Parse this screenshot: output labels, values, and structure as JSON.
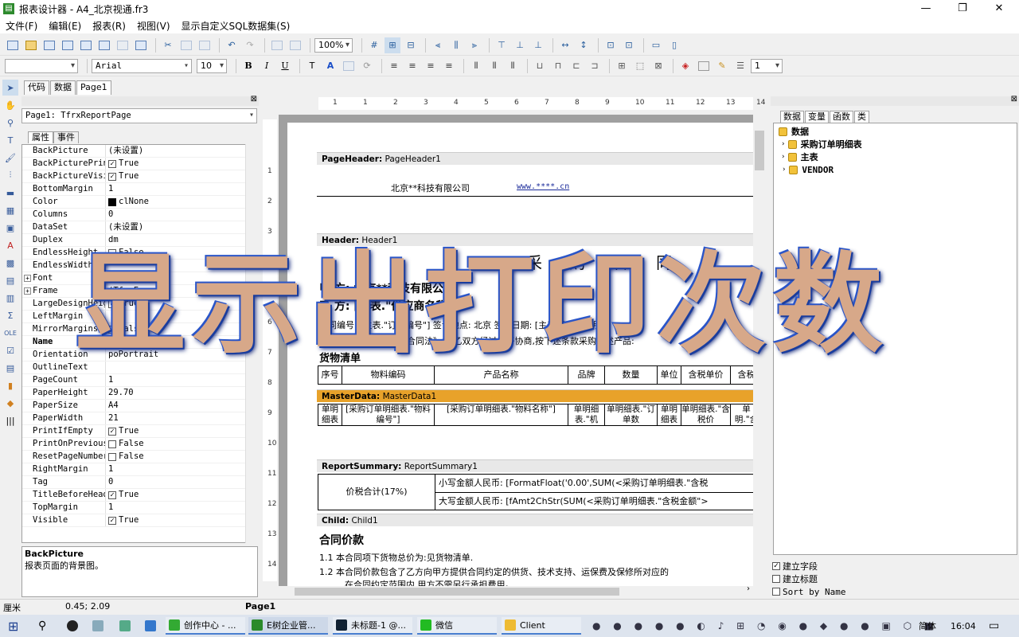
{
  "window": {
    "title": "报表设计器 - A4_北京视通.fr3",
    "minimize": "—",
    "restore": "❐",
    "close": "✕"
  },
  "menu": [
    "文件(F)",
    "编辑(E)",
    "报表(R)",
    "视图(V)",
    "显示自定义SQL数据集(S)"
  ],
  "toolbar": {
    "zoom": "100%",
    "font_name": "Arial",
    "font_size": "10",
    "line_width": "1",
    "style_combo": ""
  },
  "format_buttons": {
    "bold": "B",
    "italic": "I",
    "underline": "U"
  },
  "design_tabs": [
    "代码",
    "数据",
    "Page1"
  ],
  "page_selector": "Page1: TfrxReportPage",
  "prop_tabs": [
    "属性",
    "事件"
  ],
  "properties": [
    {
      "name": "BackPicture",
      "value": "(未设置)",
      "button": "…"
    },
    {
      "name": "BackPicturePrin",
      "value": "True",
      "check": true
    },
    {
      "name": "BackPictureVisi",
      "value": "True",
      "check": true
    },
    {
      "name": "BottomMargin",
      "value": "1"
    },
    {
      "name": "Color",
      "value": "clNone",
      "swatch": true
    },
    {
      "name": "Columns",
      "value": "0"
    },
    {
      "name": "DataSet",
      "value": "(未设置)"
    },
    {
      "name": "Duplex",
      "value": "dm"
    },
    {
      "name": "EndlessHeight",
      "value": "False",
      "check": false
    },
    {
      "name": "EndlessWidth",
      "value": ""
    },
    {
      "name": "Font",
      "value": "(TFont)",
      "expand": true
    },
    {
      "name": "Frame",
      "value": "(TfrxFrame)",
      "expand": true
    },
    {
      "name": "LargeDesignHeight",
      "value": "True",
      "check": true
    },
    {
      "name": "LeftMargin",
      "value": ""
    },
    {
      "name": "MirrorMargins",
      "value": "False",
      "check": false
    },
    {
      "name": "Name",
      "value": "Page1",
      "bold": true
    },
    {
      "name": "Orientation",
      "value": "poPortrait"
    },
    {
      "name": "OutlineText",
      "value": ""
    },
    {
      "name": "PageCount",
      "value": "1"
    },
    {
      "name": "PaperHeight",
      "value": "29.70"
    },
    {
      "name": "PaperSize",
      "value": "A4"
    },
    {
      "name": "PaperWidth",
      "value": "21"
    },
    {
      "name": "PrintIfEmpty",
      "value": "True",
      "check": true
    },
    {
      "name": "PrintOnPrevious",
      "value": "False",
      "check": false
    },
    {
      "name": "ResetPageNumber",
      "value": "False",
      "check": false
    },
    {
      "name": "RightMargin",
      "value": "1"
    },
    {
      "name": "Tag",
      "value": "0"
    },
    {
      "name": "TitleBeforeHead",
      "value": "True",
      "check": true
    },
    {
      "name": "TopMargin",
      "value": "1"
    },
    {
      "name": "Visible",
      "value": "True",
      "check": true
    }
  ],
  "description": {
    "title": "BackPicture",
    "text": "报表页面的背景图。"
  },
  "ruler_h": [
    "1",
    "1",
    "2",
    "3",
    "4",
    "5",
    "6",
    "7",
    "8",
    "9",
    "10",
    "11",
    "12",
    "13",
    "14"
  ],
  "ruler_v": [
    "1",
    "2",
    "3",
    "4",
    "5",
    "6",
    "7",
    "8",
    "9",
    "10",
    "11",
    "12",
    "13",
    "14"
  ],
  "bands": {
    "page_header": {
      "type": "PageHeader:",
      "name": "PageHeader1",
      "company": "北京**科技有限公司",
      "url": "www.****.cn"
    },
    "header": {
      "type": "Header:",
      "name": "Header1",
      "title": "采 购 合 同",
      "party_a": "甲    方: 北京**科技有限公司",
      "party_b": "乙    方: [主表.\"供应商名称\"]",
      "contract_line": "合同编号: [主表.\"订单编号\"]    签订地点: 北京        签订日期: [主表.\"订单日期\"]",
      "basis_line": "根据《中华人民共和国合同法》,甲乙双方经过友好协商,按下述条款采购下述产品:",
      "goods_title": "货物清单",
      "columns": [
        "序号",
        "物料编码",
        "产品名称",
        "品牌",
        "数量",
        "单位",
        "含税单价",
        "含税"
      ]
    },
    "master": {
      "type": "MasterData:",
      "name": "MasterData1",
      "cells": [
        "单明细表",
        "[采购订单明细表.\"物料编号\"]",
        "[采购订单明细表.\"物料名称\"]",
        "单明细表.\"机",
        "单明细表.\"订单数",
        "单明细表",
        "单明细表.\"含税价",
        "单明.\"含"
      ]
    },
    "summary": {
      "type": "ReportSummary:",
      "name": "ReportSummary1",
      "label": "价税合计(17%)",
      "small": "小写金额人民币: [FormatFloat('0.00',SUM(<采购订单明细表.\"含税",
      "big": "大写金额人民币: [fAmt2ChStr(SUM(<采购订单明细表.\"含税金额\">"
    },
    "child": {
      "type": "Child:",
      "name": "Child1",
      "title": "合同价款",
      "line1": "1.1  本合同项下货物总价为:见货物清单.",
      "line2": "1.2  本合同价款包含了乙方向甲方提供合同约定的供货、技术支持、运保费及保修所对应的",
      "line3": "在合同约定范围内,甲方不需另行承担费用。"
    }
  },
  "right_tabs": [
    "数据",
    "变量",
    "函数",
    "类"
  ],
  "tree": {
    "root": "数据",
    "children": [
      "采购订单明细表",
      "主表",
      "VENDOR"
    ]
  },
  "right_options": [
    {
      "label": "建立字段",
      "checked": true
    },
    {
      "label": "建立标题",
      "checked": false
    },
    {
      "label": "Sort by Name",
      "checked": false
    }
  ],
  "status": {
    "unit": "厘米",
    "coords": "0.45; 2.09",
    "page": "Page1"
  },
  "taskbar": {
    "items": [
      "创作中心 - ...",
      "E树企业管...",
      "未标题-1 @...",
      "微信",
      "Client"
    ],
    "lang": "简体",
    "time": "16:04"
  },
  "overlay_text": "显示出打印次数"
}
